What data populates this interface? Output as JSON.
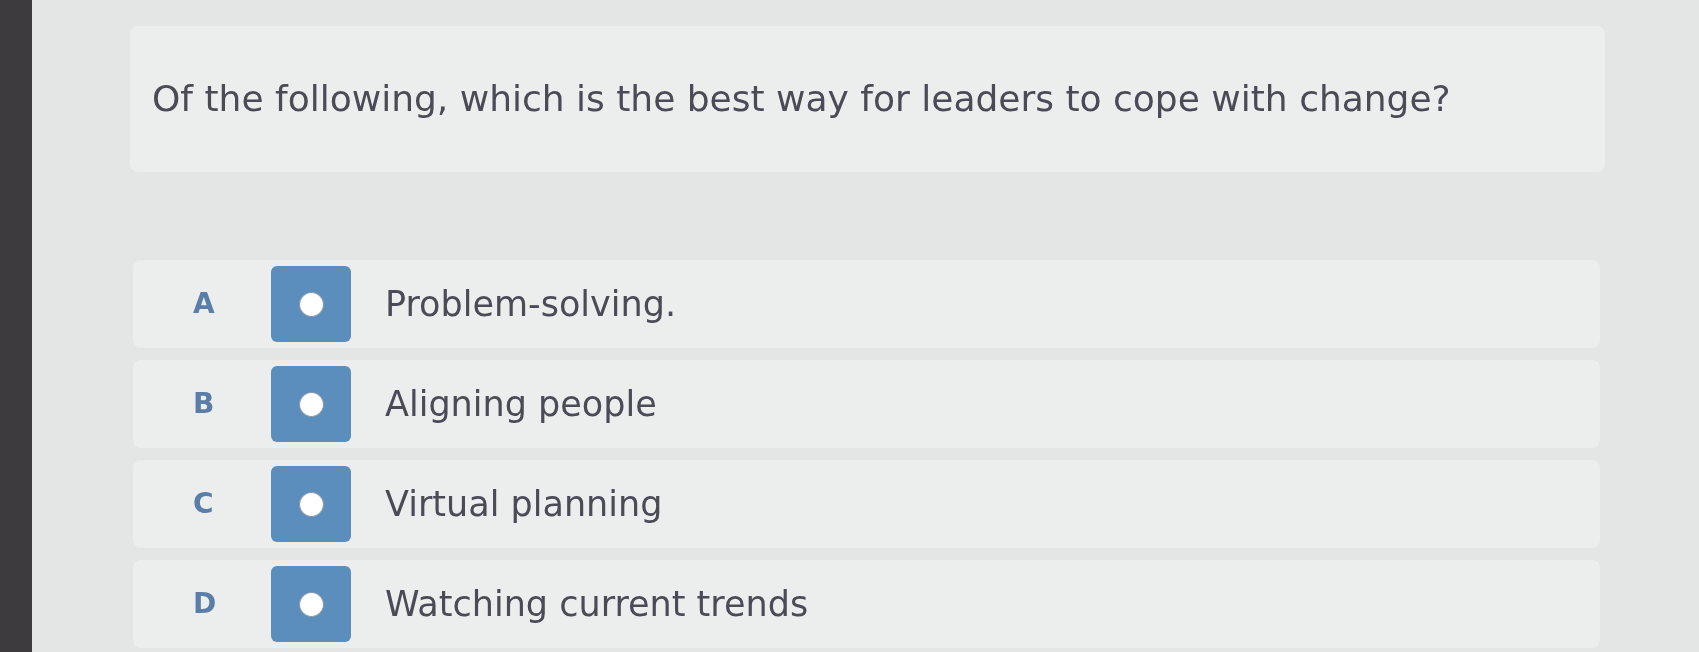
{
  "question": {
    "text": "Of the following, which is the best way for leaders to cope with change?"
  },
  "options": [
    {
      "letter": "A",
      "text": "Problem-solving.",
      "selected": false
    },
    {
      "letter": "B",
      "text": "Aligning people",
      "selected": false
    },
    {
      "letter": "C",
      "text": "Virtual planning",
      "selected": false
    },
    {
      "letter": "D",
      "text": "Watching current trends",
      "selected": false
    }
  ]
}
